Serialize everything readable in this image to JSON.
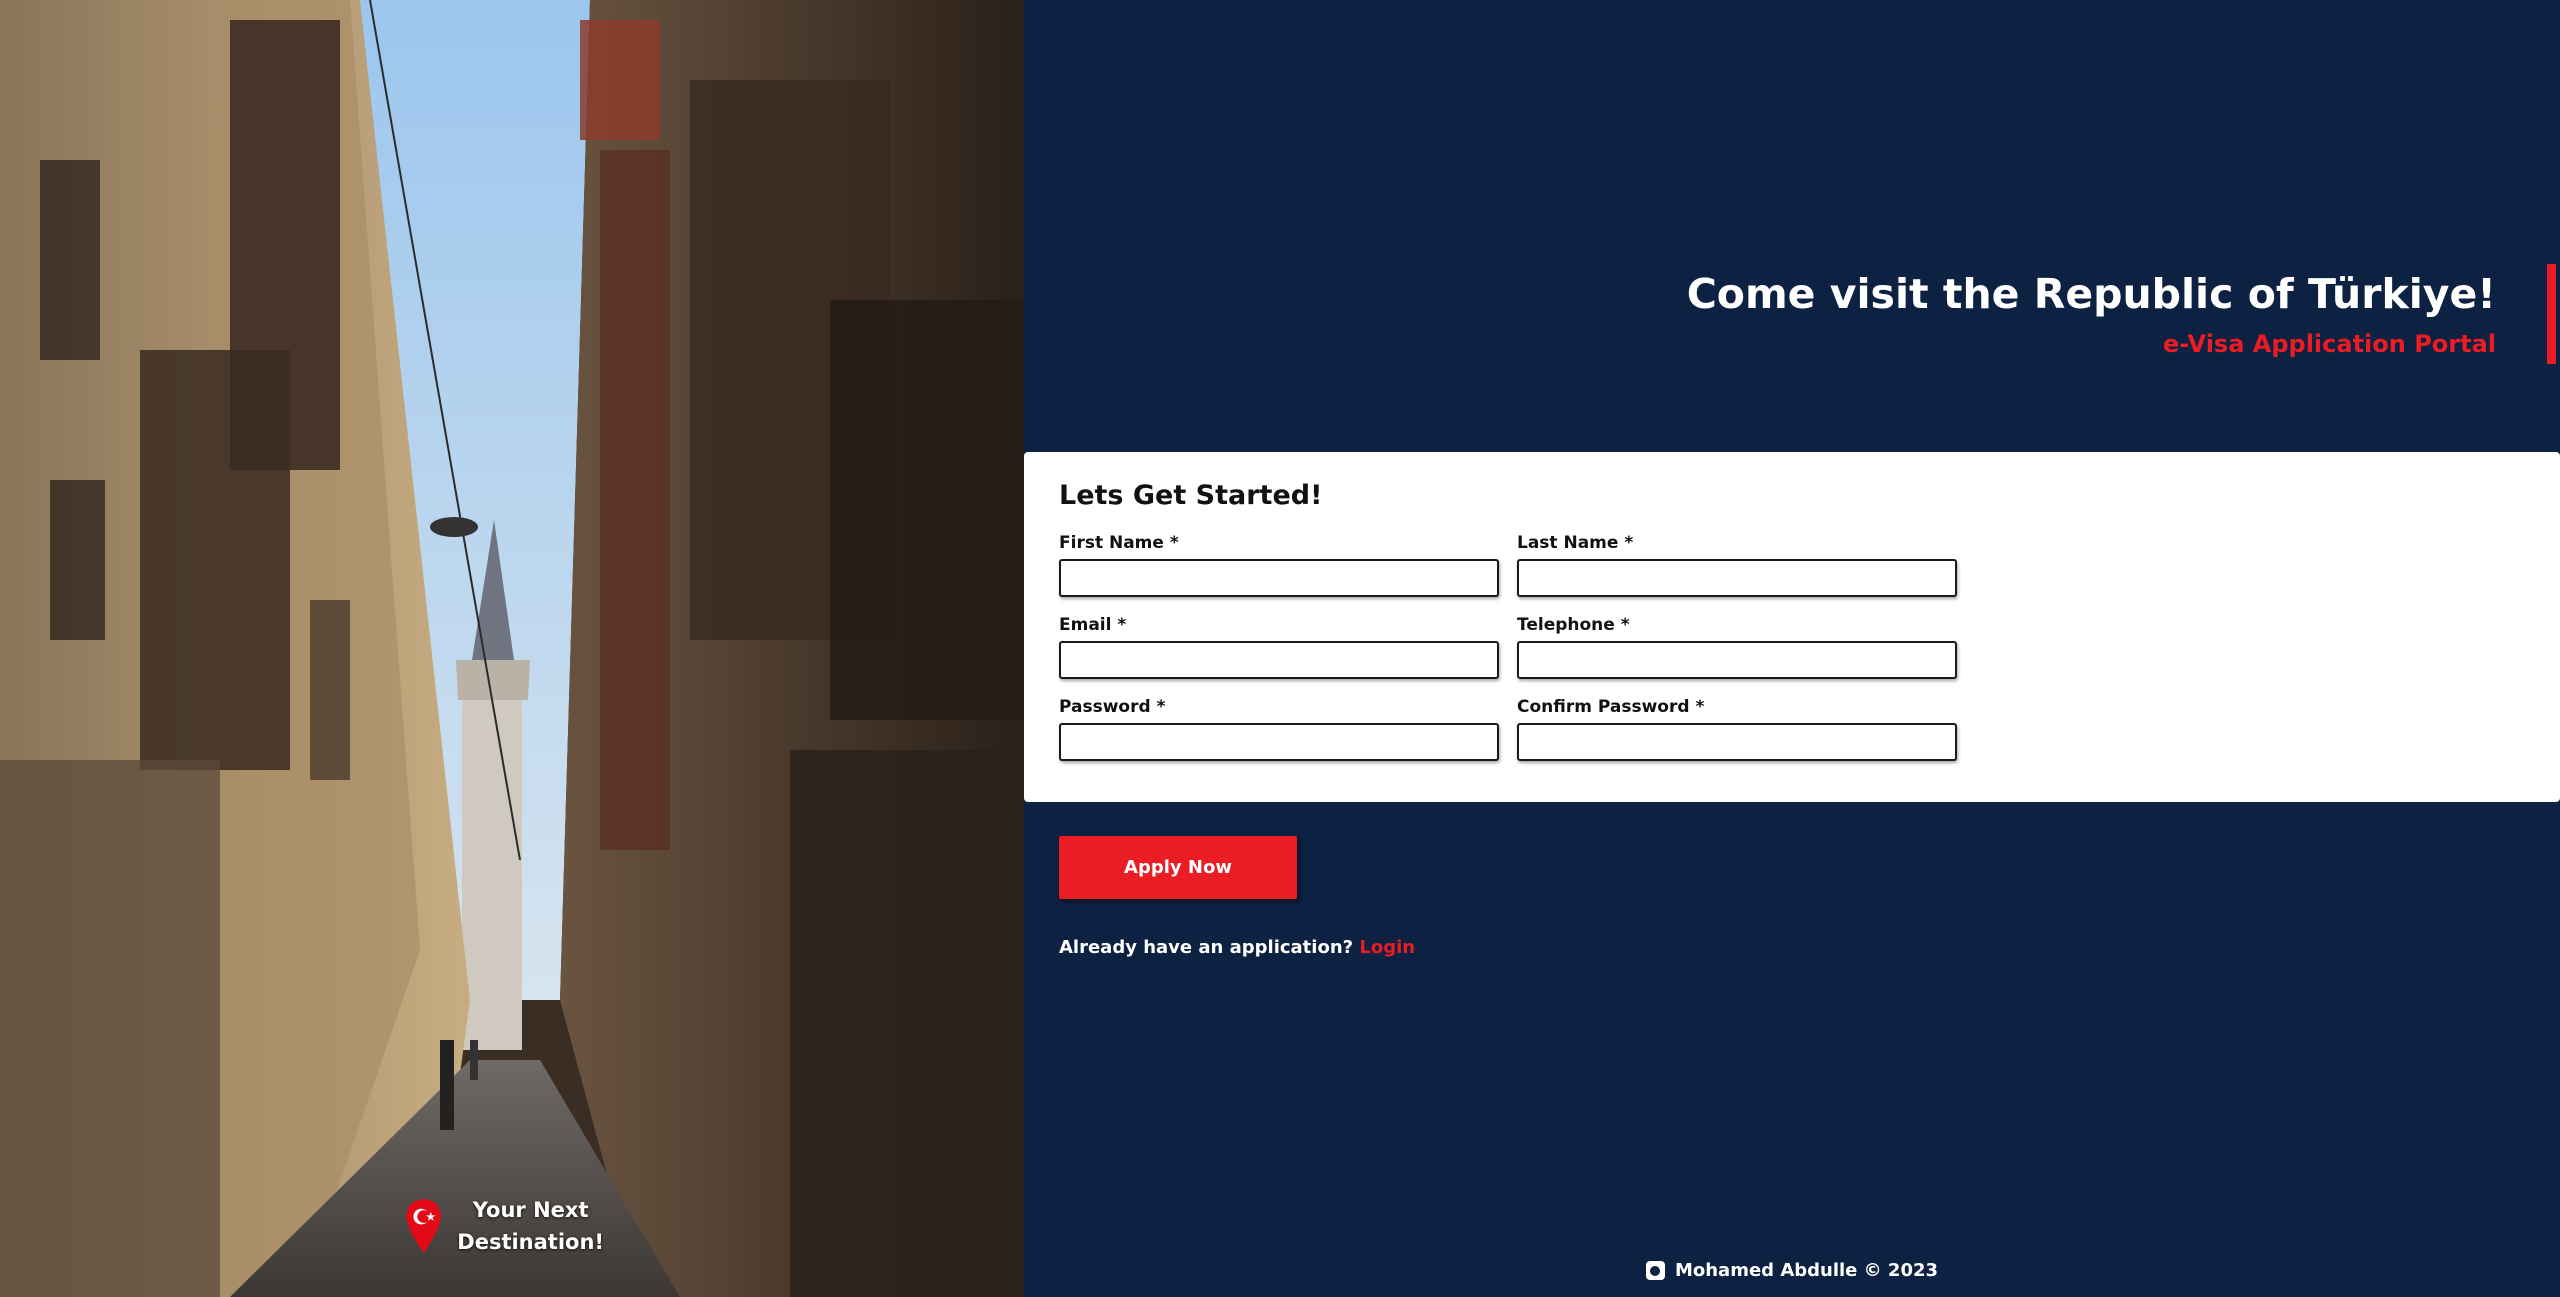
{
  "photo": {
    "badge_line1": "Your Next",
    "badge_line2": "Destination!",
    "pin_icon": "turkey-flag-location-pin"
  },
  "hero": {
    "title": "Come visit the Republic of Türkiye!",
    "subtitle": "e-Visa Application Portal"
  },
  "form": {
    "title": "Lets Get Started!",
    "first_name_label": "First Name *",
    "last_name_label": "Last Name *",
    "email_label": "Email *",
    "telephone_label": "Telephone *",
    "password_label": "Password *",
    "confirm_password_label": "Confirm Password *",
    "first_name_value": "",
    "last_name_value": "",
    "email_value": "",
    "telephone_value": "",
    "password_value": "",
    "confirm_password_value": ""
  },
  "actions": {
    "apply_label": "Apply Now",
    "login_prompt": "Already have an application?",
    "login_label": "Login"
  },
  "footer": {
    "text": "Mohamed Abdulle © 2023",
    "icon": "github-icon"
  },
  "colors": {
    "navy": "#0d2142",
    "accent_red": "#ea1c24"
  }
}
